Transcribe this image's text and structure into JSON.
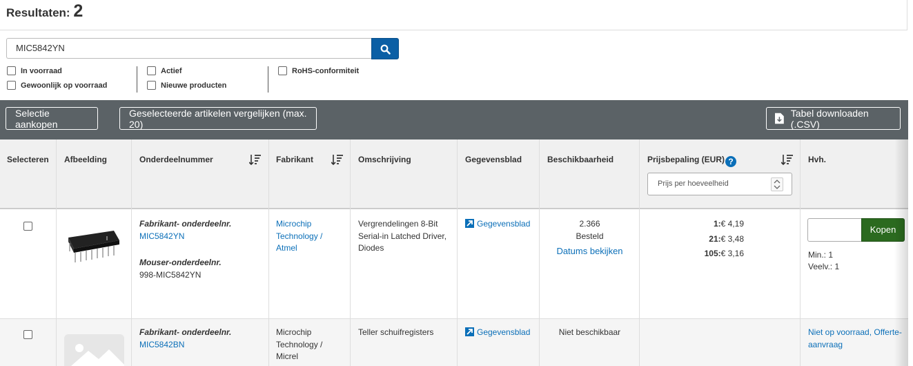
{
  "results": {
    "label": "Resultaten:",
    "count": "2"
  },
  "search": {
    "value": "MIC5842YN"
  },
  "filters": {
    "in_stock": "In voorraad",
    "normally_stocked": "Gewoonlijk op voorraad",
    "active": "Actief",
    "new_products": "Nieuwe producten",
    "rohs": "RoHS-conformiteit"
  },
  "toolbar": {
    "buy_selection": "Selectie aankopen",
    "compare": "Geselecteerde artikelen vergelijken (max. 20)",
    "download": "Tabel downloaden (.CSV)"
  },
  "columns": {
    "select": "Selecteren",
    "image": "Afbeelding",
    "part_number": "Onderdeelnummer",
    "manufacturer": "Fabrikant",
    "description": "Omschrijving",
    "datasheet": "Gegevensblad",
    "availability": "Beschikbaarheid",
    "pricing": "Prijsbepaling (EUR)",
    "qty": "Hvh.",
    "price_select_placeholder": "Prijs per hoeveelheid"
  },
  "rows": [
    {
      "mfr_pn_label": "Fabrikant- onderdeelnr.",
      "mfr_pn": "MIC5842YN",
      "mouser_pn_label": "Mouser-onderdeelnr.",
      "mouser_pn": "998-MIC5842YN",
      "manufacturer": [
        "Microchip",
        "Technology /",
        "Atmel"
      ],
      "description": [
        "Vergrendelingen 8-Bit",
        "Serial-in Latched Driver,",
        "Diodes"
      ],
      "datasheet": "Gegevensblad",
      "stock": "2.366",
      "stock_status": "Besteld",
      "view_dates": "Datums bekijken",
      "prices": [
        {
          "qty": "1:",
          "price": "€ 4,19"
        },
        {
          "qty": "21:",
          "price": "€ 3,48"
        },
        {
          "qty": "105:",
          "price": "€ 3,16"
        }
      ],
      "buy": "Kopen",
      "min": "Min.: 1",
      "mult": "Veelv.: 1"
    },
    {
      "mfr_pn_label": "Fabrikant- onderdeelnr.",
      "mfr_pn": "MIC5842BN",
      "manufacturer": [
        "Microchip",
        "Technology /",
        "Micrel"
      ],
      "description": [
        "Teller schuifregisters"
      ],
      "datasheet": "Gegevensblad",
      "availability": "Niet beschikbaar",
      "quote": [
        "Niet op voorraad, Offerte-",
        "aanvraag"
      ]
    }
  ],
  "colors": {
    "primary_blue": "#0b5fa5",
    "buy_green": "#2b6a1f",
    "toolbar_gray": "#5b6266",
    "link": "#0b6fb8"
  }
}
